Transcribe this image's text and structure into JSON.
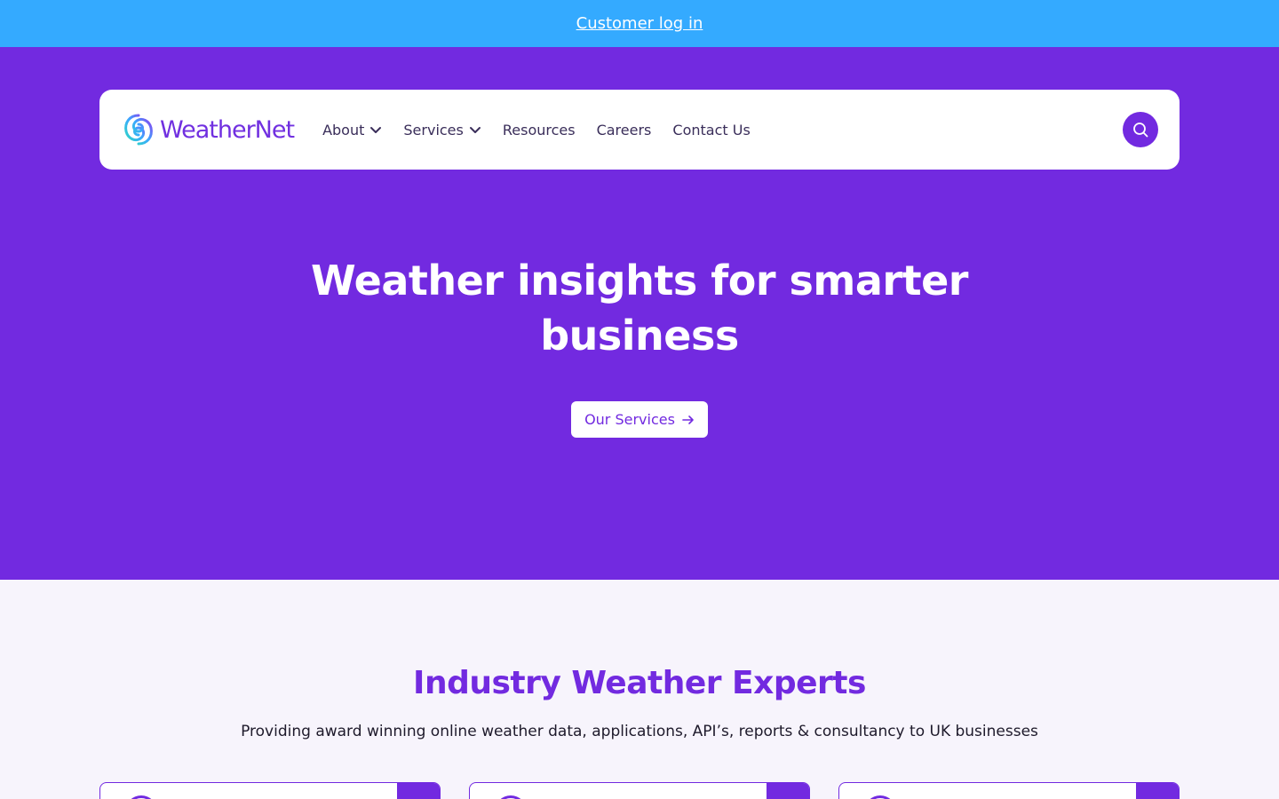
{
  "top_bar": {
    "login_link": "Customer log in"
  },
  "header": {
    "logo_text": "WeatherNet",
    "nav": [
      {
        "label": "About",
        "has_dropdown": true
      },
      {
        "label": "Services",
        "has_dropdown": true
      },
      {
        "label": "Resources",
        "has_dropdown": false
      },
      {
        "label": "Careers",
        "has_dropdown": false
      },
      {
        "label": "Contact Us",
        "has_dropdown": false
      }
    ],
    "search_icon": "search-icon"
  },
  "hero": {
    "title_line1": "Weather insights for smarter",
    "title_line2": "business",
    "cta_label": "Our Services",
    "cta_icon": "arrow-right-icon"
  },
  "section": {
    "title": "Industry Weather Experts",
    "subtitle": "Providing award winning online weather data, applications, API’s, reports & consultancy to UK businesses",
    "card_count": 3
  },
  "colors": {
    "top_bar": "#34aaff",
    "brand_purple": "#722ae0",
    "page_background": "#f7f4fc",
    "white": "#ffffff"
  }
}
